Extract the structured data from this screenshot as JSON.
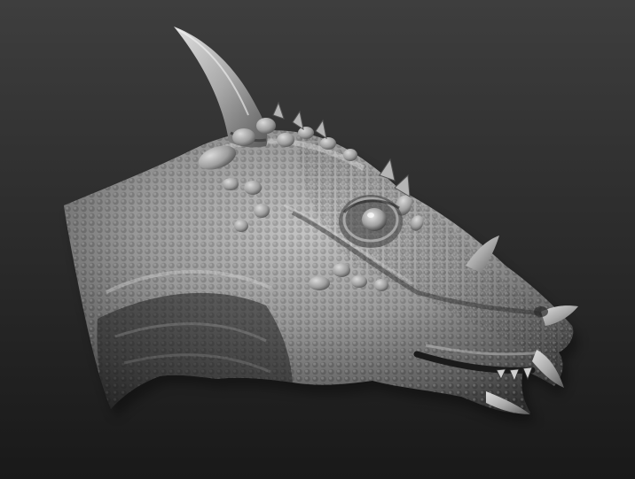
{
  "viewport": {
    "background_top": "#3e3e3e",
    "background_bottom": "#191919",
    "material_color": "#9a9a9a"
  },
  "sculpt": {
    "subject": "dragon-head-sculpt",
    "features": [
      "horn",
      "eye",
      "cheek-spikes",
      "scales",
      "open-jaw",
      "neck-folds"
    ]
  }
}
